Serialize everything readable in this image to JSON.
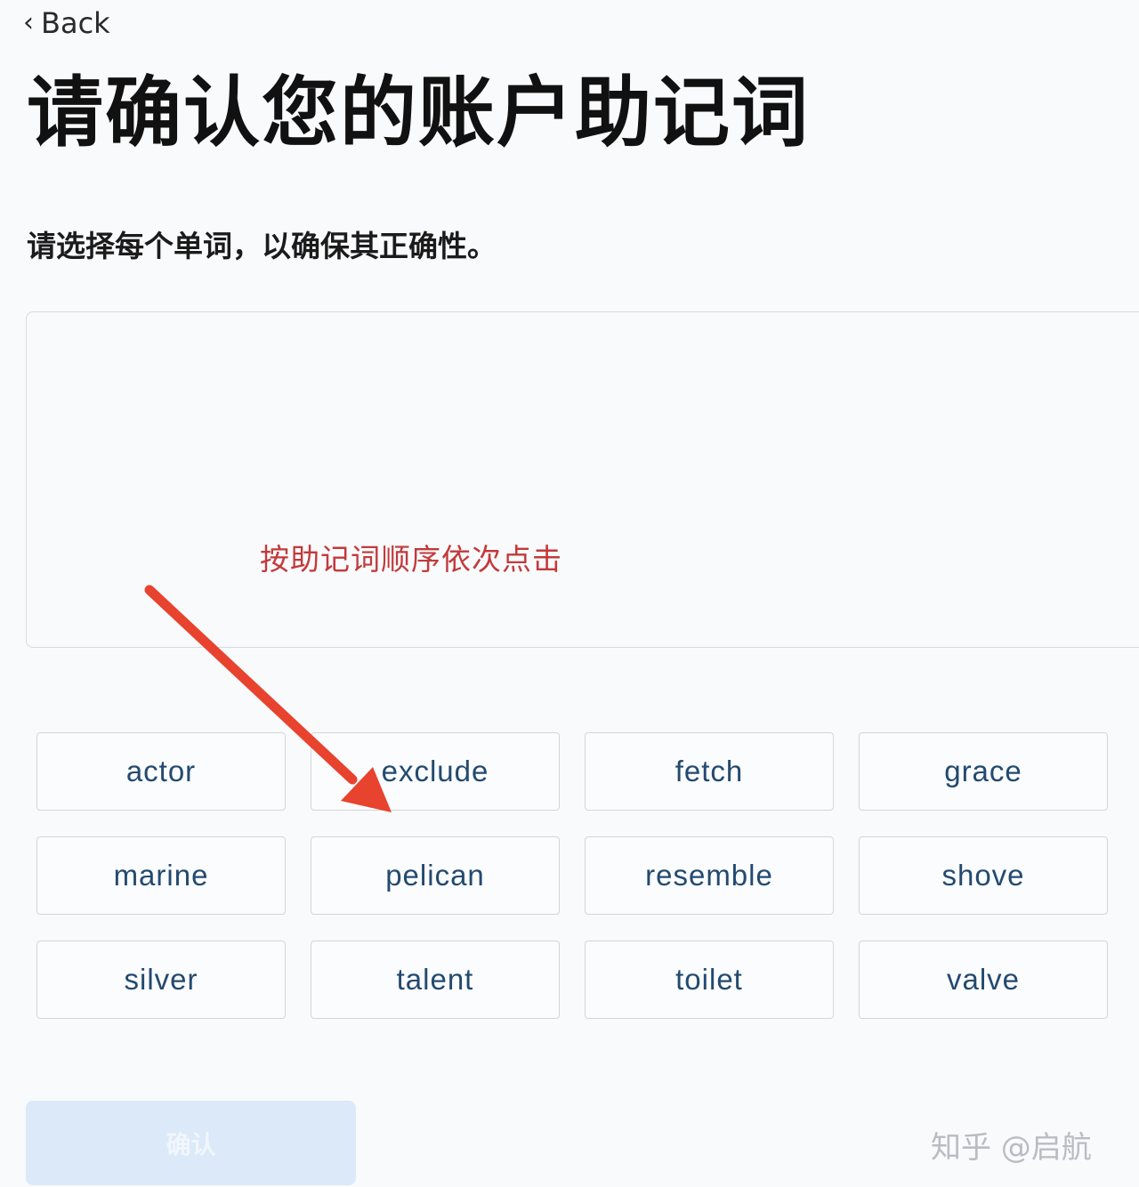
{
  "nav": {
    "back_label": "Back",
    "back_icon": "chevron-left-icon"
  },
  "page": {
    "title": "请确认您的账户助记词",
    "subtitle": "请选择每个单词，以确保其正确性。"
  },
  "annotation": {
    "hint": "按助记词顺序依次点击",
    "color": "#c23a3a"
  },
  "words": [
    "actor",
    "exclude",
    "fetch",
    "grace",
    "marine",
    "pelican",
    "resemble",
    "shove",
    "silver",
    "talent",
    "toilet",
    "valve"
  ],
  "footer": {
    "confirm_label": "确认"
  },
  "watermark": "知乎 @启航",
  "colors": {
    "word_text": "#234a6f",
    "word_border": "#d0d6de",
    "confirm_bg_disabled": "#dbe9f8",
    "arrow": "#e8432e"
  }
}
